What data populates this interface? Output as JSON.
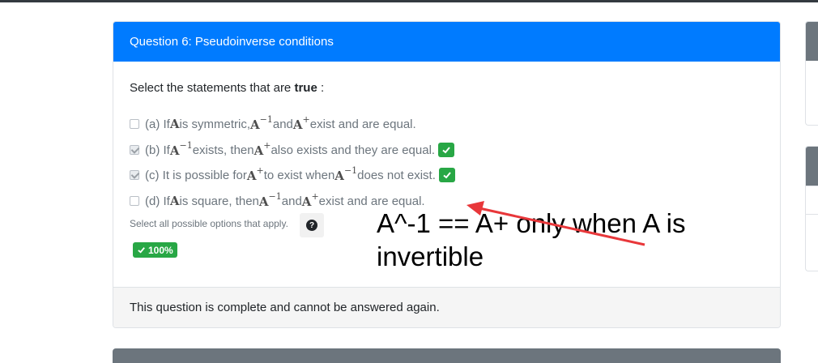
{
  "question": {
    "header_title": "Question 6: Pseudoinverse conditions",
    "prompt_prefix": "Select the statements that are ",
    "prompt_bold": "true",
    "prompt_suffix": " :",
    "options": [
      {
        "label": "(a)",
        "checked": false,
        "correct_badge": false,
        "parts": [
          "If ",
          "A",
          " is symmetric, ",
          "A",
          "−1",
          " and ",
          "A",
          "+",
          " exist and are equal."
        ]
      },
      {
        "label": "(b)",
        "checked": true,
        "correct_badge": true,
        "parts": [
          "If ",
          "A",
          "−1",
          " exists, then ",
          "A",
          "+",
          " also exists and they are equal."
        ]
      },
      {
        "label": "(c)",
        "checked": true,
        "correct_badge": true,
        "parts": [
          "It is possible for ",
          "A",
          "+",
          " to exist when ",
          "A",
          "−1",
          " does not exist."
        ]
      },
      {
        "label": "(d)",
        "checked": false,
        "correct_badge": false,
        "parts": [
          "If ",
          "A",
          " is square, then ",
          "A",
          "−1",
          " and ",
          "A",
          "+",
          " exist and are equal."
        ]
      }
    ],
    "help_text": "Select all possible options that apply.",
    "help_icon": "question-circle-icon",
    "score": "100%",
    "footer_text": "This question is complete and cannot be answered again."
  },
  "annotation": {
    "text": "A^-1 == A+ only when A is invertible",
    "arrow_color": "#e8373a"
  },
  "colors": {
    "header_bg": "#007bff",
    "success": "#28a745",
    "muted_text": "#6c757d",
    "side_header": "#6c757d"
  }
}
